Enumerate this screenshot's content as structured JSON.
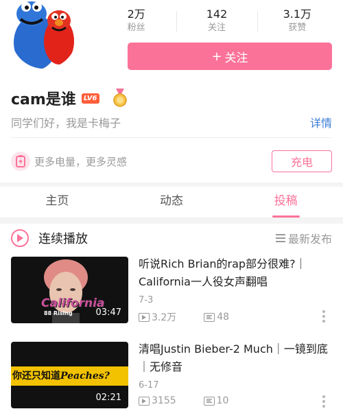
{
  "profile": {
    "username": "cam是谁",
    "level": "LV6",
    "bio": "同学们好，我是卡梅子",
    "details_link": "详情"
  },
  "stats": [
    {
      "value": "2万",
      "label": "粉丝"
    },
    {
      "value": "142",
      "label": "关注"
    },
    {
      "value": "3.1万",
      "label": "获赞"
    }
  ],
  "follow_button": {
    "icon": "plus-icon",
    "label": "关注"
  },
  "charge": {
    "text": "更多电量，更多灵感",
    "button_label": "充电"
  },
  "tabs": [
    {
      "label": "主页"
    },
    {
      "label": "动态"
    },
    {
      "label": "投稿"
    }
  ],
  "active_tab": "投稿",
  "playlist": {
    "play_label": "连续播放",
    "sort_label": "最新发布"
  },
  "videos": [
    {
      "title": "听说Rich  Brian的rap部分很难?｜California一人役女声翻唱",
      "date": "7-3",
      "views": "3.2万",
      "danmaku": "48",
      "duration": "03:47",
      "thumb_text": "California",
      "thumb_subtext": "88 Rising"
    },
    {
      "title": "清唱Justin  Bieber-2  Much｜一镜到底｜无修音",
      "date": "6-17",
      "views": "3155",
      "danmaku": "10",
      "duration": "02:21",
      "thumb_text_cn": "你还只知道",
      "thumb_text_en": "Peaches?"
    }
  ],
  "colors": {
    "accent": "#fb7299",
    "link": "#3a7bd5",
    "level_badge": "#ff5e3a"
  }
}
